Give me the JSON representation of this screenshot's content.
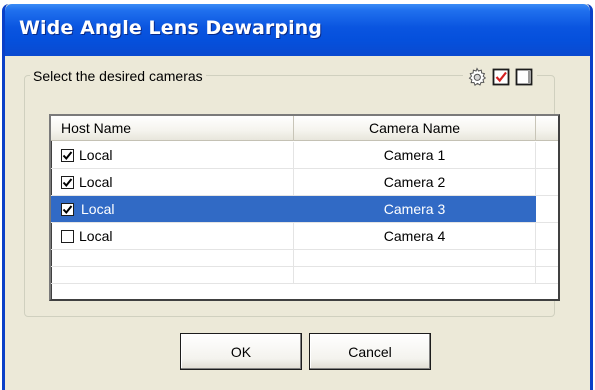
{
  "window": {
    "title": "Wide Angle Lens Dewarping"
  },
  "group": {
    "legend": "Select the desired cameras",
    "tools": [
      {
        "name": "settings",
        "icon": "gear-icon"
      },
      {
        "name": "check-all",
        "icon": "checkbox-checked-icon"
      },
      {
        "name": "uncheck-all",
        "icon": "checkbox-empty-icon"
      }
    ]
  },
  "list": {
    "columns": [
      "Host Name",
      "Camera Name"
    ],
    "rows": [
      {
        "host": "Local",
        "camera": "Camera 1",
        "checked": true,
        "selected": false
      },
      {
        "host": "Local",
        "camera": "Camera 2",
        "checked": true,
        "selected": false
      },
      {
        "host": "Local",
        "camera": "Camera 3",
        "checked": true,
        "selected": true
      },
      {
        "host": "Local",
        "camera": "Camera 4",
        "checked": false,
        "selected": false
      }
    ]
  },
  "buttons": {
    "ok": "OK",
    "cancel": "Cancel"
  },
  "colors": {
    "titlebar": "#0a55e0",
    "selection": "#316ac5",
    "face": "#ece9d8",
    "check_accent": "#d42020"
  }
}
